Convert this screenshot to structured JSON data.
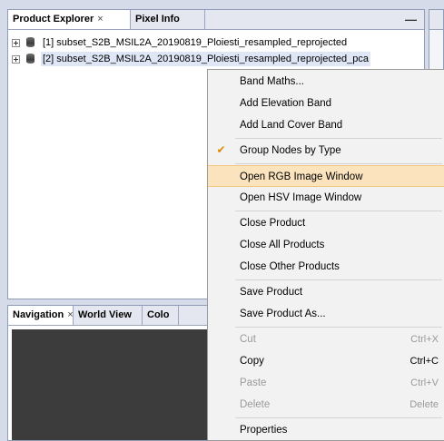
{
  "explorer": {
    "tabs": [
      {
        "label": "Product Explorer",
        "close": "×"
      },
      {
        "label": "Pixel Info"
      }
    ],
    "minimize": "—",
    "products": [
      {
        "label": "[1] subset_S2B_MSIL2A_20190819_Ploiesti_resampled_reprojected"
      },
      {
        "label": "[2] subset_S2B_MSIL2A_20190819_Ploiesti_resampled_reprojected_pca"
      }
    ]
  },
  "navigation": {
    "tabs": [
      {
        "label": "Navigation",
        "close": "×"
      },
      {
        "label": "World View"
      },
      {
        "label": "Colo"
      }
    ]
  },
  "context_menu": {
    "items": [
      {
        "label": "Band Maths..."
      },
      {
        "label": "Add Elevation Band"
      },
      {
        "label": "Add Land Cover Band"
      },
      {
        "label": "Group Nodes by Type",
        "checked": true,
        "check": "✔"
      },
      {
        "label": "Open RGB Image Window",
        "highlighted": true
      },
      {
        "label": "Open HSV Image Window"
      },
      {
        "label": "Close Product"
      },
      {
        "label": "Close All Products"
      },
      {
        "label": "Close Other Products"
      },
      {
        "label": "Save Product"
      },
      {
        "label": "Save Product As..."
      },
      {
        "label": "Cut",
        "shortcut": "Ctrl+X",
        "disabled": true
      },
      {
        "label": "Copy",
        "shortcut": "Ctrl+C"
      },
      {
        "label": "Paste",
        "shortcut": "Ctrl+V",
        "disabled": true
      },
      {
        "label": "Delete",
        "shortcut": "Delete",
        "disabled": true
      },
      {
        "label": "Properties"
      }
    ]
  },
  "colors": {
    "highlight": "#fbe4bd",
    "check_mark": "#e08a00",
    "navigation_canvas": "#3c3c3c"
  }
}
